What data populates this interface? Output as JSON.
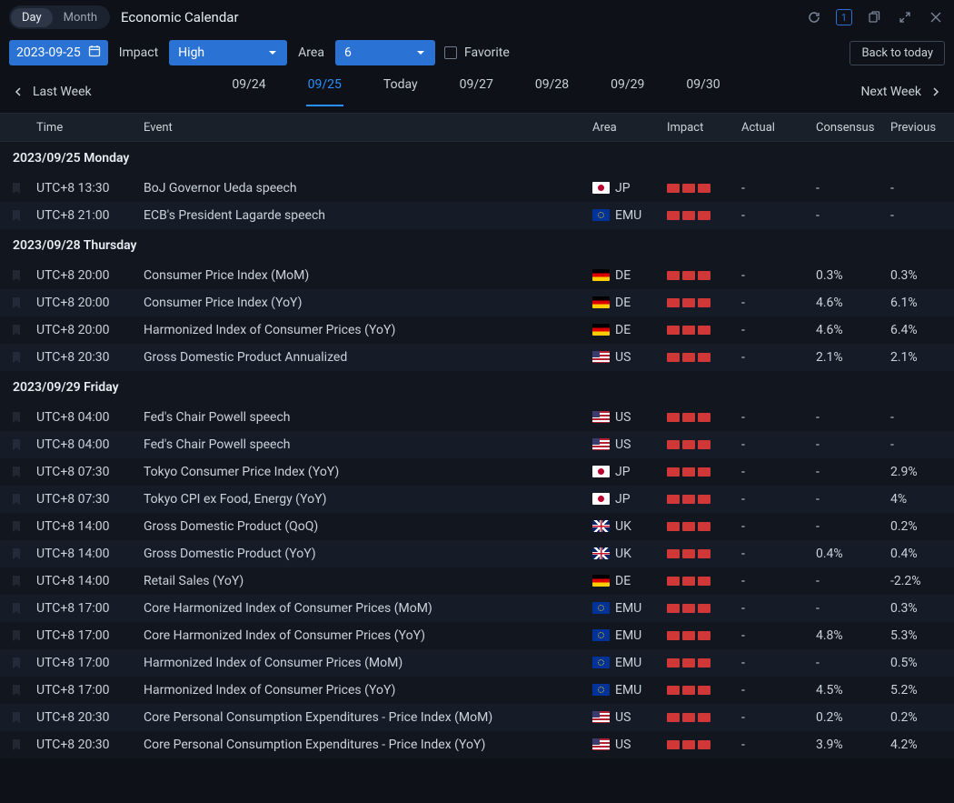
{
  "header": {
    "view_day": "Day",
    "view_month": "Month",
    "title": "Economic Calendar",
    "one_badge": "1"
  },
  "filters": {
    "date": "2023-09-25",
    "impact_label": "Impact",
    "impact_value": "High",
    "area_label": "Area",
    "area_value": "6",
    "favorite_label": "Favorite",
    "back_to_today": "Back to today"
  },
  "nav": {
    "last_week": "Last Week",
    "next_week": "Next Week",
    "days": [
      "09/24",
      "09/25",
      "Today",
      "09/27",
      "09/28",
      "09/29",
      "09/30"
    ],
    "active_index": 1
  },
  "columns": {
    "time": "Time",
    "event": "Event",
    "area": "Area",
    "impact": "Impact",
    "actual": "Actual",
    "consensus": "Consensus",
    "previous": "Previous"
  },
  "groups": [
    {
      "label": "2023/09/25 Monday",
      "rows": [
        {
          "time": "UTC+8 13:30",
          "event": "BoJ Governor Ueda speech",
          "area": "JP",
          "actual": "-",
          "consensus": "-",
          "previous": "-"
        },
        {
          "time": "UTC+8 21:00",
          "event": "ECB's President Lagarde speech",
          "area": "EMU",
          "actual": "-",
          "consensus": "-",
          "previous": "-"
        }
      ]
    },
    {
      "label": "2023/09/28 Thursday",
      "rows": [
        {
          "time": "UTC+8 20:00",
          "event": "Consumer Price Index (MoM)",
          "area": "DE",
          "actual": "-",
          "consensus": "0.3%",
          "previous": "0.3%"
        },
        {
          "time": "UTC+8 20:00",
          "event": "Consumer Price Index (YoY)",
          "area": "DE",
          "actual": "-",
          "consensus": "4.6%",
          "previous": "6.1%"
        },
        {
          "time": "UTC+8 20:00",
          "event": "Harmonized Index of Consumer Prices (YoY)",
          "area": "DE",
          "actual": "-",
          "consensus": "4.6%",
          "previous": "6.4%"
        },
        {
          "time": "UTC+8 20:30",
          "event": "Gross Domestic Product Annualized",
          "area": "US",
          "actual": "-",
          "consensus": "2.1%",
          "previous": "2.1%"
        }
      ]
    },
    {
      "label": "2023/09/29 Friday",
      "rows": [
        {
          "time": "UTC+8 04:00",
          "event": "Fed's Chair Powell speech",
          "area": "US",
          "actual": "-",
          "consensus": "-",
          "previous": "-"
        },
        {
          "time": "UTC+8 04:00",
          "event": "Fed's Chair Powell speech",
          "area": "US",
          "actual": "-",
          "consensus": "-",
          "previous": "-"
        },
        {
          "time": "UTC+8 07:30",
          "event": "Tokyo Consumer Price Index (YoY)",
          "area": "JP",
          "actual": "-",
          "consensus": "-",
          "previous": "2.9%"
        },
        {
          "time": "UTC+8 07:30",
          "event": "Tokyo CPI ex Food, Energy (YoY)",
          "area": "JP",
          "actual": "-",
          "consensus": "-",
          "previous": "4%"
        },
        {
          "time": "UTC+8 14:00",
          "event": "Gross Domestic Product (QoQ)",
          "area": "UK",
          "actual": "-",
          "consensus": "-",
          "previous": "0.2%"
        },
        {
          "time": "UTC+8 14:00",
          "event": "Gross Domestic Product (YoY)",
          "area": "UK",
          "actual": "-",
          "consensus": "0.4%",
          "previous": "0.4%"
        },
        {
          "time": "UTC+8 14:00",
          "event": "Retail Sales (YoY)",
          "area": "DE",
          "actual": "-",
          "consensus": "-",
          "previous": "-2.2%"
        },
        {
          "time": "UTC+8 17:00",
          "event": "Core Harmonized Index of Consumer Prices (MoM)",
          "area": "EMU",
          "actual": "-",
          "consensus": "-",
          "previous": "0.3%"
        },
        {
          "time": "UTC+8 17:00",
          "event": "Core Harmonized Index of Consumer Prices (YoY)",
          "area": "EMU",
          "actual": "-",
          "consensus": "4.8%",
          "previous": "5.3%"
        },
        {
          "time": "UTC+8 17:00",
          "event": "Harmonized Index of Consumer Prices (MoM)",
          "area": "EMU",
          "actual": "-",
          "consensus": "-",
          "previous": "0.5%"
        },
        {
          "time": "UTC+8 17:00",
          "event": "Harmonized Index of Consumer Prices (YoY)",
          "area": "EMU",
          "actual": "-",
          "consensus": "4.5%",
          "previous": "5.2%"
        },
        {
          "time": "UTC+8 20:30",
          "event": "Core Personal Consumption Expenditures - Price Index (MoM)",
          "area": "US",
          "actual": "-",
          "consensus": "0.2%",
          "previous": "0.2%"
        },
        {
          "time": "UTC+8 20:30",
          "event": "Core Personal Consumption Expenditures - Price Index (YoY)",
          "area": "US",
          "actual": "-",
          "consensus": "3.9%",
          "previous": "4.2%"
        }
      ]
    }
  ]
}
